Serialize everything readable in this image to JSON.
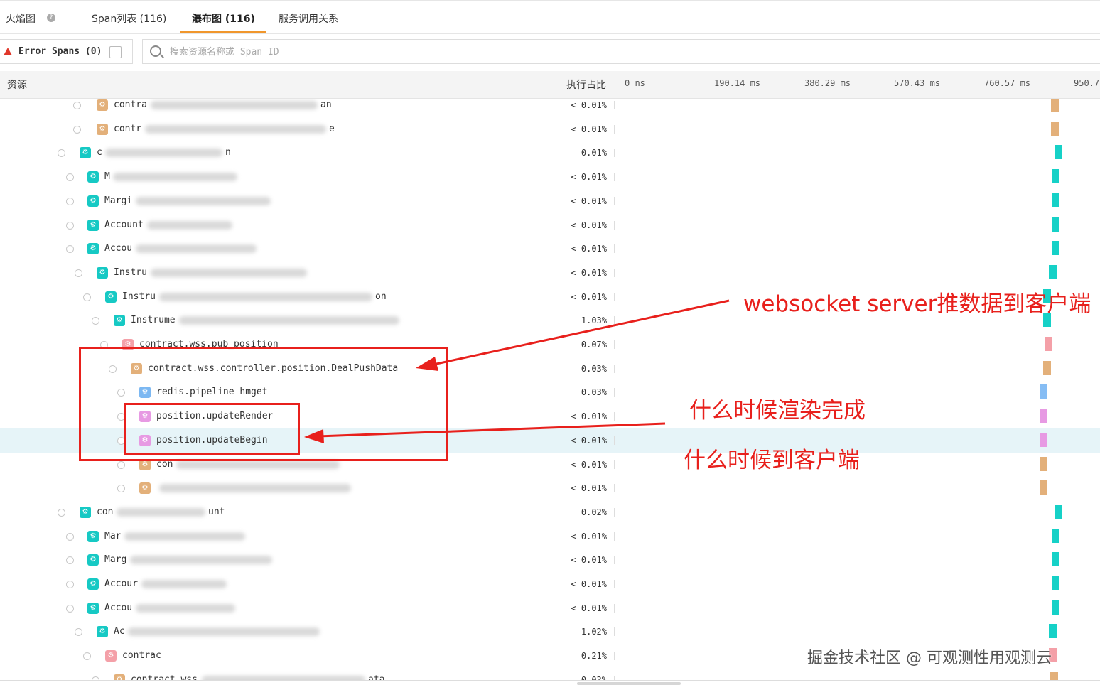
{
  "tabs": {
    "items": [
      {
        "label": "火焰图"
      },
      {
        "label": "Span列表 (116)"
      },
      {
        "label": "瀑布图 (116)"
      },
      {
        "label": "服务调用关系"
      }
    ],
    "help_glyph": "?"
  },
  "filter": {
    "error_label": "Error Spans (0)",
    "search_placeholder": "搜索资源名称或 Span ID"
  },
  "header": {
    "resource": "资源",
    "exec_ratio": "执行占比",
    "ticks": [
      "0 ns",
      "190.14 ms",
      "380.29 ms",
      "570.43 ms",
      "760.57 ms",
      "950.7"
    ]
  },
  "rows": [
    {
      "name": "contra",
      "suffix": "an",
      "pct": "< 0.01%",
      "color": "#e3b07a",
      "bar": "#e3b07a"
    },
    {
      "name": "contr",
      "suffix": "e",
      "pct": "< 0.01%",
      "color": "#e3b07a",
      "bar": "#e3b07a"
    },
    {
      "name": "c",
      "suffix": "n",
      "pct": "0.01%",
      "color": "#16c9c4",
      "bar": "#16d1c7"
    },
    {
      "name": "M",
      "suffix": "",
      "pct": "< 0.01%",
      "color": "#16c9c4",
      "bar": "#16d1c7"
    },
    {
      "name": "Margi",
      "suffix": "",
      "pct": "< 0.01%",
      "color": "#16c9c4",
      "bar": "#16d1c7"
    },
    {
      "name": "Account",
      "suffix": "",
      "pct": "< 0.01%",
      "color": "#16c9c4",
      "bar": "#16d1c7"
    },
    {
      "name": "Accou",
      "suffix": "",
      "pct": "< 0.01%",
      "color": "#16c9c4",
      "bar": "#16d1c7"
    },
    {
      "name": "Instru",
      "suffix": "",
      "pct": "< 0.01%",
      "color": "#16c9c4",
      "bar": "#16d1c7"
    },
    {
      "name": "Instru",
      "suffix": "on",
      "pct": "< 0.01%",
      "color": "#16c9c4",
      "bar": "#16d1c7"
    },
    {
      "name": "Instrume",
      "suffix": "",
      "pct": "1.03%",
      "color": "#16c9c4",
      "bar": "#16d1c7"
    },
    {
      "name": "contract.wss.pub_position",
      "suffix": "",
      "pct": "0.07%",
      "color": "#f4a0a8",
      "bar": "#f4a0a8"
    },
    {
      "name": "contract.wss.controller.position.DealPushData",
      "suffix": "",
      "pct": "0.03%",
      "color": "#e3b07a",
      "bar": "#e3b07a"
    },
    {
      "name": "redis.pipeline hmget",
      "suffix": "",
      "pct": "0.03%",
      "color": "#7cb8f2",
      "bar": "#86bdf4"
    },
    {
      "name": "position.updateRender",
      "suffix": "",
      "pct": "< 0.01%",
      "color": "#e79ae3",
      "bar": "#e79ae3"
    },
    {
      "name": "position.updateBegin",
      "suffix": "",
      "pct": "< 0.01%",
      "color": "#e79ae3",
      "bar": "#e79ae3"
    },
    {
      "name": "con",
      "suffix": "",
      "pct": "< 0.01%",
      "color": "#e3b07a",
      "bar": "#e3b07a"
    },
    {
      "name": "",
      "suffix": "",
      "pct": "< 0.01%",
      "color": "#e3b07a",
      "bar": "#e3b07a"
    },
    {
      "name": "con",
      "suffix": "unt",
      "pct": "0.02%",
      "color": "#16c9c4",
      "bar": "#16d1c7"
    },
    {
      "name": "Mar",
      "suffix": "",
      "pct": "< 0.01%",
      "color": "#16c9c4",
      "bar": "#16d1c7"
    },
    {
      "name": "Marg",
      "suffix": "",
      "pct": "< 0.01%",
      "color": "#16c9c4",
      "bar": "#16d1c7"
    },
    {
      "name": "Accour",
      "suffix": "",
      "pct": "< 0.01%",
      "color": "#16c9c4",
      "bar": "#16d1c7"
    },
    {
      "name": "Accou",
      "suffix": "",
      "pct": "< 0.01%",
      "color": "#16c9c4",
      "bar": "#16d1c7"
    },
    {
      "name": "Ac",
      "suffix": "",
      "pct": "1.02%",
      "color": "#16c9c4",
      "bar": "#16d1c7"
    },
    {
      "name": "contrac",
      "suffix": "",
      "pct": "0.21%",
      "color": "#f4a0a8",
      "bar": "#f4a0a8"
    },
    {
      "name": "contract.wss",
      "suffix": "ata",
      "pct": "0.03%",
      "color": "#e3b07a",
      "bar": "#e3b07a"
    }
  ],
  "annotations": {
    "push": "websocket server推数据到客户端",
    "render_done": "什么时候渲染完成",
    "arrive": "什么时候到客户端"
  },
  "watermark": "掘金技术社区 @ 可观测性用观测云"
}
